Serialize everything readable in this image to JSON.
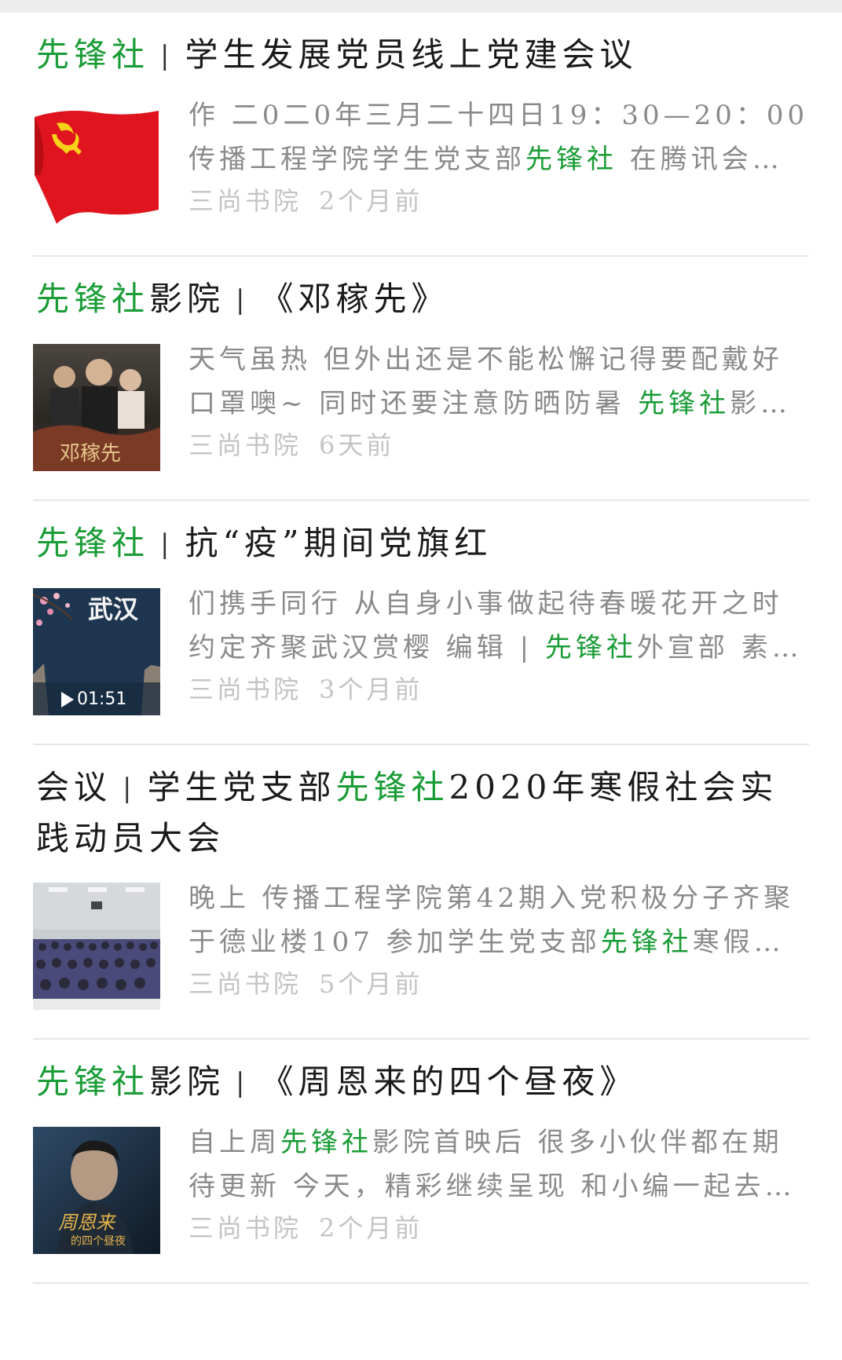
{
  "colors": {
    "highlight": "#1a9c36",
    "title": "#1a1a1a",
    "snippet": "#8a8a8a",
    "meta": "#c4c4c4",
    "divider": "#e6e6e6"
  },
  "results": [
    {
      "title_parts": [
        {
          "text": "先锋社",
          "hl": true
        },
        {
          "text": "|",
          "sep": true
        },
        {
          "text": "学生发展党员线上党建会议",
          "hl": false
        }
      ],
      "thumb_icon": "party-flag-icon",
      "snippet_parts": [
        {
          "text": "作 二0二0年三月二十四日19：30—20：00 传播工程学院学生党支部",
          "hl": false
        },
        {
          "text": "先锋社",
          "hl": true
        },
        {
          "text": " 在腾讯会议a…",
          "hl": false
        }
      ],
      "source": "三尚书院",
      "ago": "2个月前"
    },
    {
      "title_parts": [
        {
          "text": "先锋社",
          "hl": true
        },
        {
          "text": "影院",
          "hl": false
        },
        {
          "text": "|",
          "sep": true
        },
        {
          "text": "《邓稼先》",
          "hl": false
        }
      ],
      "thumb_icon": "movie-poster-icon",
      "snippet_parts": [
        {
          "text": "天气虽热 但外出还是不能松懈记得要配戴好口罩噢~ 同时还要注意防晒防暑 ",
          "hl": false
        },
        {
          "text": "先锋社",
          "hl": true
        },
        {
          "text": "影…",
          "hl": false
        }
      ],
      "source": "三尚书院",
      "ago": "6天前"
    },
    {
      "title_parts": [
        {
          "text": "先锋社",
          "hl": true
        },
        {
          "text": "|",
          "sep": true
        },
        {
          "text": "抗“疫”期间党旗红",
          "hl": false
        }
      ],
      "thumb_icon": "video-thumbnail-icon",
      "video_duration": "01:51",
      "snippet_parts": [
        {
          "text": "们携手同行 从自身小事做起待春暖花开之时约定齐聚武汉赏樱 编辑 | ",
          "hl": false
        },
        {
          "text": "先锋社",
          "hl": true
        },
        {
          "text": "外宣部 素…",
          "hl": false
        }
      ],
      "source": "三尚书院",
      "ago": "3个月前"
    },
    {
      "title_parts": [
        {
          "text": "会议",
          "hl": false
        },
        {
          "text": "|",
          "sep": true
        },
        {
          "text": "学生党支部",
          "hl": false
        },
        {
          "text": "先锋社",
          "hl": true
        },
        {
          "text": "2020年寒假社会实践动员大会",
          "hl": false
        }
      ],
      "thumb_icon": "meeting-photo-icon",
      "snippet_parts": [
        {
          "text": "晚上 传播工程学院第42期入党积极分子齐聚于德业楼107 参加学生党支部",
          "hl": false
        },
        {
          "text": "先锋社",
          "hl": true
        },
        {
          "text": "寒假社…",
          "hl": false
        }
      ],
      "source": "三尚书院",
      "ago": "5个月前"
    },
    {
      "title_parts": [
        {
          "text": "先锋社",
          "hl": true
        },
        {
          "text": "影院",
          "hl": false
        },
        {
          "text": "|",
          "sep": true
        },
        {
          "text": "《周恩来的四个昼夜》",
          "hl": false
        }
      ],
      "thumb_icon": "portrait-poster-icon",
      "snippet_parts": [
        {
          "text": "自上周",
          "hl": false
        },
        {
          "text": "先锋社",
          "hl": true
        },
        {
          "text": "影院首映后 很多小伙伴都在期待更新 今天，精彩继续呈现 和小编一起去…",
          "hl": false
        }
      ],
      "source": "三尚书院",
      "ago": "2个月前"
    }
  ]
}
